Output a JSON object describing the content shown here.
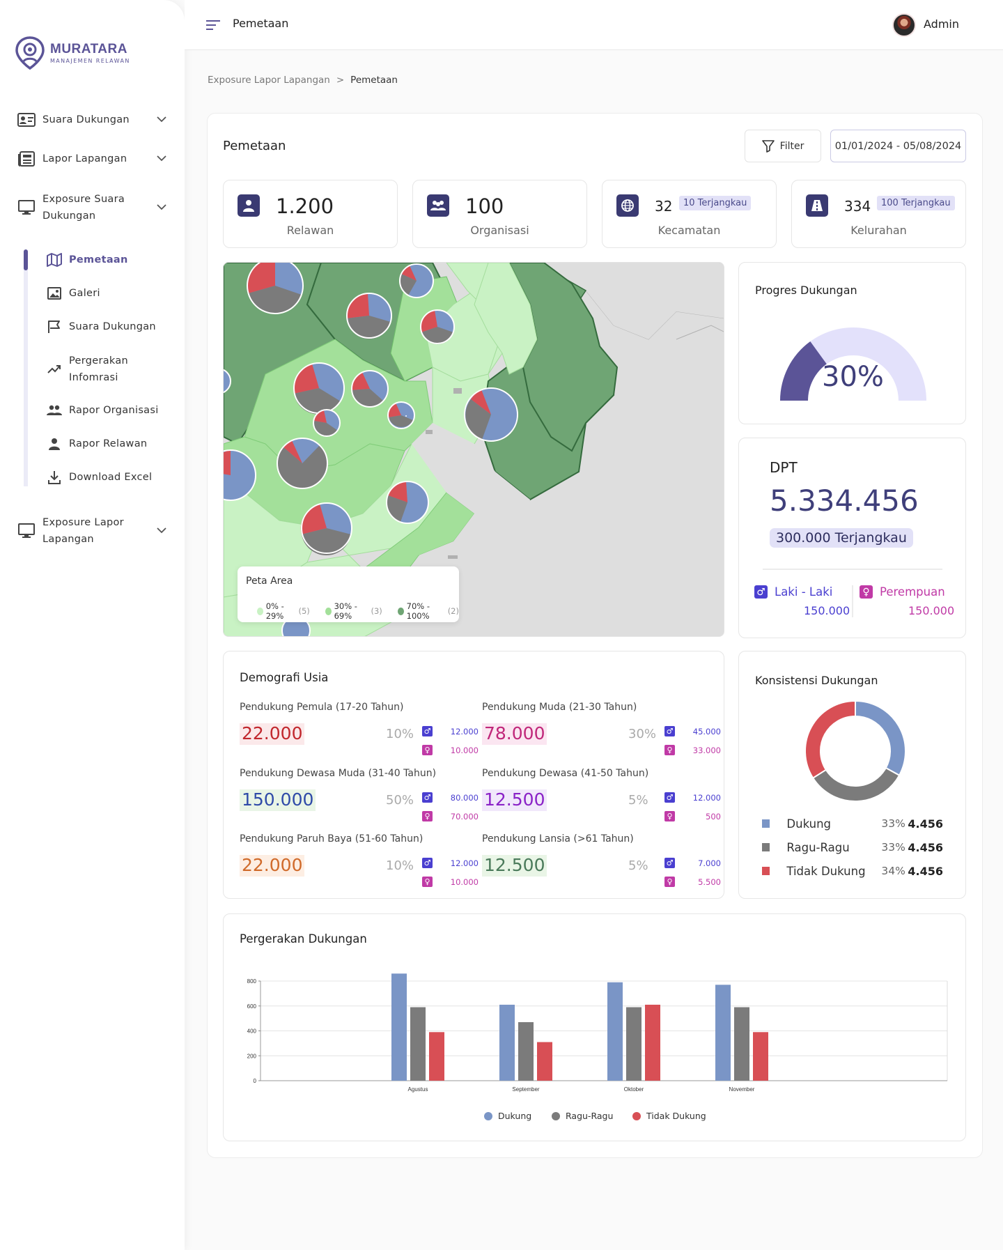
{
  "app": {
    "name": "MURATARA",
    "tagline": "MANAJEMEN RELAWAN"
  },
  "sidebar": {
    "groups": [
      {
        "label": "Suara  Dukungan"
      },
      {
        "label": "Lapor Lapangan"
      },
      {
        "label": "Exposure Suara Dukungan",
        "line1": "Exposure Suara",
        "line2": "Dukungan"
      },
      {
        "label": "Exposure Lapor Lapangan",
        "line1": "Exposure Lapor",
        "line2": "Lapangan"
      }
    ],
    "items": [
      {
        "label": "Pemetaan",
        "icon": "map-icon",
        "active": true
      },
      {
        "label": "Galeri",
        "icon": "image-icon"
      },
      {
        "label": "Suara Dukungan",
        "icon": "flag-icon"
      },
      {
        "label": "Pergerakan Infomrasi",
        "line1": "Pergerakan",
        "line2": "Infomrasi",
        "icon": "trend-icon"
      },
      {
        "label": "Rapor Organisasi",
        "icon": "group-icon"
      },
      {
        "label": "Rapor Relawan",
        "icon": "user-icon"
      },
      {
        "label": "Download Excel",
        "icon": "download-icon"
      }
    ]
  },
  "topbar": {
    "page": "Pemetaan",
    "user": "Admin"
  },
  "breadcrumb": {
    "parent": "Exposure Lapor Lapangan",
    "sep": ">",
    "current": "Pemetaan"
  },
  "header": {
    "title": "Pemetaan",
    "filter_label": "Filter",
    "date_range": "01/01/2024 - 05/08/2024"
  },
  "stats": [
    {
      "value": "1.200",
      "label": "Relawan",
      "icon": "user-icon"
    },
    {
      "value": "100",
      "label": "Organisasi",
      "icon": "group-icon"
    },
    {
      "value": "32",
      "badge": "10 Terjangkau",
      "label": "Kecamatan",
      "icon": "globe-icon"
    },
    {
      "value": "334",
      "badge": "100 Terjangkau",
      "label": "Kelurahan",
      "icon": "road-icon"
    }
  ],
  "map": {
    "legend_title": "Peta Area",
    "legend": [
      {
        "label": "0% - 29%",
        "count": "(5)",
        "color": "#c9f2c4"
      },
      {
        "label": "30% - 69%",
        "count": "(3)",
        "color": "#a3e09a"
      },
      {
        "label": "70% - 100%",
        "count": "(2)",
        "color": "#6fa574"
      }
    ],
    "colors": {
      "dukung": "#7a95c6",
      "ragu": "#7b7b7b",
      "tidak": "#d84f55"
    }
  },
  "progres": {
    "title": "Progres Dukungan",
    "value": "30%",
    "fraction": 0.3
  },
  "dpt": {
    "label": "DPT",
    "value": "5.334.456",
    "badge": "300.000 Terjangkau",
    "male_label": "Laki - Laki",
    "male_value": "150.000",
    "female_label": "Perempuan",
    "female_value": "150.000"
  },
  "demografi": {
    "title": "Demografi Usia",
    "groups": [
      {
        "title": "Pendukung  Pemula (17-20 Tahun)",
        "value": "22.000",
        "percent": "10%",
        "male": "12.000",
        "female": "10.000",
        "color": "#c1272d",
        "bg": "#fbe9ea"
      },
      {
        "title": "Pendukung Muda (21-30 Tahun)",
        "value": "78.000",
        "percent": "30%",
        "male": "45.000",
        "female": "33.000",
        "color": "#c0277a",
        "bg": "#fbe6f1"
      },
      {
        "title": "Pendukung  Dewasa Muda (31-40 Tahun)",
        "value": "150.000",
        "percent": "50%",
        "male": "80.000",
        "female": "70.000",
        "color": "#2f4aa8",
        "bg": "#e9f5e6"
      },
      {
        "title": "Pendukung Dewasa (41-50 Tahun)",
        "value": "12.500",
        "percent": "5%",
        "male": "12.000",
        "female": "500",
        "color": "#8a22c7",
        "bg": "#f1e8fb"
      },
      {
        "title": "Pendukung  Paruh Baya (51-60 Tahun)",
        "value": "22.000",
        "percent": "10%",
        "male": "12.000",
        "female": "10.000",
        "color": "#d06a2a",
        "bg": "#fdeee3"
      },
      {
        "title": "Pendukung Lansia (>61 Tahun)",
        "value": "12.500",
        "percent": "5%",
        "male": "7.000",
        "female": "5.500",
        "color": "#4a7a5a",
        "bg": "#e9f5e6"
      }
    ]
  },
  "konsistensi": {
    "title": "Konsistensi  Dukungan",
    "rows": [
      {
        "label": "Dukung",
        "percent": "33%",
        "value": "4.456",
        "color": "#7a95c6"
      },
      {
        "label": "Ragu-Ragu",
        "percent": "33%",
        "value": "4.456",
        "color": "#7b7b7b"
      },
      {
        "label": "Tidak Dukung",
        "percent": "34%",
        "value": "4.456",
        "color": "#d84f55"
      }
    ]
  },
  "chart_data": {
    "type": "bar",
    "title": "Pergerakan Dukungan",
    "categories": [
      "Agustus",
      "September",
      "Oktober",
      "November"
    ],
    "series": [
      {
        "name": "Dukung",
        "color": "#7a95c6",
        "values": [
          860,
          610,
          790,
          770
        ]
      },
      {
        "name": "Ragu-Ragu",
        "color": "#7b7b7b",
        "values": [
          590,
          470,
          590,
          590
        ]
      },
      {
        "name": "Tidak Dukung",
        "color": "#d84f55",
        "values": [
          390,
          310,
          610,
          390
        ]
      }
    ],
    "yticks": [
      "0",
      "200",
      "400",
      "600",
      "800"
    ],
    "ylim": [
      0,
      800
    ],
    "grid": true,
    "legend": "bottom"
  }
}
